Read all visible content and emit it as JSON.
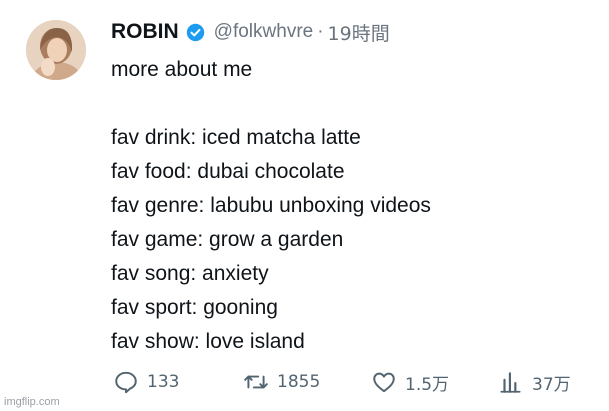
{
  "tweet": {
    "display_name": "ROBIN",
    "handle": "@folkwhvre",
    "separator": "·",
    "time": "19時間",
    "verified_color": "#1d9bf0",
    "lines": [
      "more about me",
      "",
      "fav drink: iced matcha latte",
      "fav food: dubai chocolate",
      "fav genre: labubu unboxing videos",
      "fav game: grow a garden",
      "fav song: anxiety",
      "fav sport: gooning",
      "fav show: love island"
    ]
  },
  "actions": {
    "reply": {
      "icon": "reply-icon",
      "count": "133"
    },
    "retweet": {
      "icon": "retweet-icon",
      "count": "1855"
    },
    "like": {
      "icon": "heart-icon",
      "count": "1.5万"
    },
    "views": {
      "icon": "views-icon",
      "count": "37万"
    }
  },
  "watermark": "imgflip.com"
}
